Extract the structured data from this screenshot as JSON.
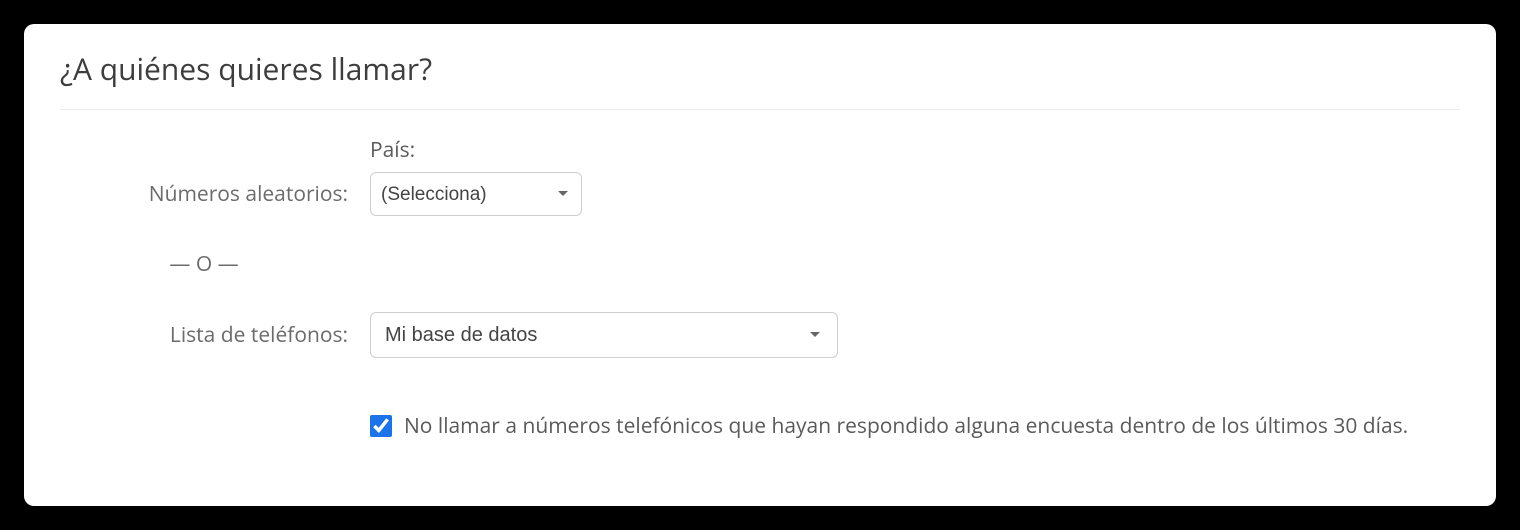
{
  "title": "¿A quiénes quieres llamar?",
  "random": {
    "label": "Números aleatorios:",
    "country_label": "País:",
    "select_placeholder": "(Selecciona)"
  },
  "divider": "— O —",
  "phonelist": {
    "label": "Lista de teléfonos:",
    "selected": "Mi base de datos"
  },
  "exclude": {
    "label": "No llamar a números telefónicos que hayan respondido alguna encuesta dentro de los últimos 30 días.",
    "checked": true
  }
}
